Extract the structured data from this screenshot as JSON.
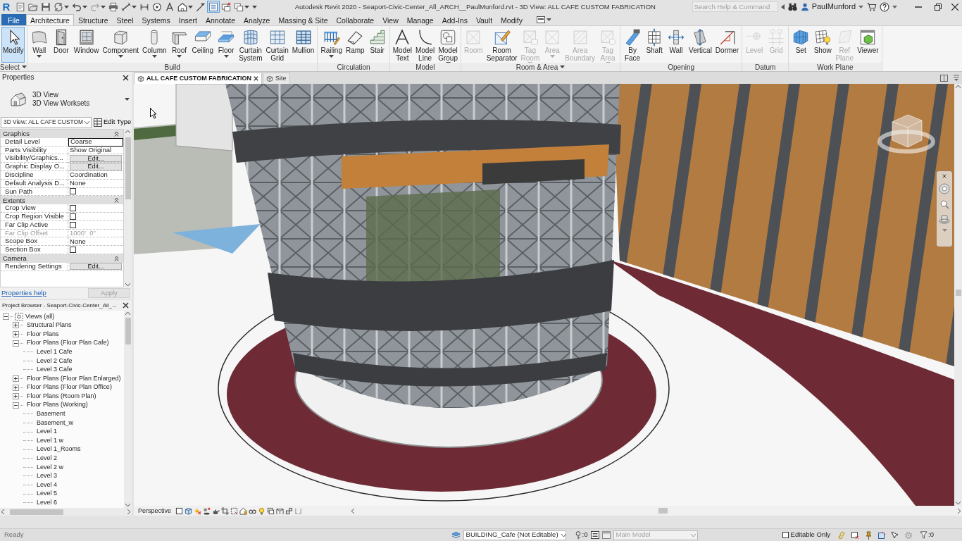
{
  "title_bar": {
    "logo": "R",
    "quick_access": [
      {
        "has_menu": false,
        "on": false,
        "disabled": false
      },
      {
        "has_menu": false,
        "on": false,
        "disabled": false
      },
      {
        "has_menu": false,
        "on": false,
        "disabled": false
      },
      {
        "has_menu": true,
        "on": false,
        "disabled": false
      },
      {
        "has_menu": true,
        "on": false,
        "disabled": false
      },
      {
        "has_menu": true,
        "on": false,
        "disabled": true
      },
      {
        "has_menu": false,
        "on": false,
        "disabled": false
      },
      {
        "has_menu": true,
        "on": false,
        "disabled": false
      },
      {
        "has_menu": false,
        "on": false,
        "disabled": false
      },
      {
        "has_menu": false,
        "on": false,
        "disabled": false
      },
      {
        "has_menu": false,
        "on": false,
        "disabled": false
      },
      {
        "has_menu": true,
        "on": false,
        "disabled": false
      },
      {
        "has_menu": false,
        "on": false,
        "disabled": false
      },
      {
        "has_menu": false,
        "on": true,
        "disabled": false
      },
      {
        "has_menu": false,
        "on": false,
        "disabled": false
      },
      {
        "has_menu": true,
        "on": false,
        "disabled": false
      }
    ],
    "title": "Autodesk Revit 2020 - Seaport-Civic-Center_All_ARCH__PaulMunford.rvt - 3D View: ALL CAFE CUSTOM FABRICATION",
    "search": {
      "placeholder": "Search Help & Command"
    },
    "user": "PaulMunford"
  },
  "ribbon_tabs": [
    {
      "label": "File",
      "kind": "application",
      "selected": false
    },
    {
      "label": "Architecture",
      "kind": "tab",
      "selected": true
    },
    {
      "label": "Structure",
      "kind": "tab",
      "selected": false
    },
    {
      "label": "Steel",
      "kind": "tab",
      "selected": false
    },
    {
      "label": "Systems",
      "kind": "tab",
      "selected": false
    },
    {
      "label": "Insert",
      "kind": "tab",
      "selected": false
    },
    {
      "label": "Annotate",
      "kind": "tab",
      "selected": false
    },
    {
      "label": "Analyze",
      "kind": "tab",
      "selected": false
    },
    {
      "label": "Massing & Site",
      "kind": "tab",
      "selected": false
    },
    {
      "label": "Collaborate",
      "kind": "tab",
      "selected": false
    },
    {
      "label": "View",
      "kind": "tab",
      "selected": false
    },
    {
      "label": "Manage",
      "kind": "tab",
      "selected": false
    },
    {
      "label": "Add-Ins",
      "kind": "tab",
      "selected": false
    },
    {
      "label": "Vault",
      "kind": "tab",
      "selected": false
    },
    {
      "label": "Modify",
      "kind": "tab",
      "selected": false
    }
  ],
  "ribbon_panels": [
    {
      "title": "Select",
      "has_menu": true,
      "buttons": [
        {
          "label": "Modify",
          "selected": true,
          "disabled": false,
          "has_menu": false
        }
      ]
    },
    {
      "title": "Build",
      "has_menu": false,
      "buttons": [
        {
          "label": "Wall",
          "selected": false,
          "disabled": false,
          "has_menu": true
        },
        {
          "label": "Door",
          "selected": false,
          "disabled": false,
          "has_menu": false
        },
        {
          "label": "Window",
          "selected": false,
          "disabled": false,
          "has_menu": false
        },
        {
          "label": "Component",
          "selected": false,
          "disabled": false,
          "has_menu": true
        },
        {
          "label": "Column",
          "selected": false,
          "disabled": false,
          "has_menu": true
        },
        {
          "label": "Roof",
          "selected": false,
          "disabled": false,
          "has_menu": true
        },
        {
          "label": "Ceiling",
          "selected": false,
          "disabled": false,
          "has_menu": false
        },
        {
          "label": "Floor",
          "selected": false,
          "disabled": false,
          "has_menu": true
        },
        {
          "label": "Curtain System",
          "selected": false,
          "disabled": false,
          "has_menu": false
        },
        {
          "label": "Curtain Grid",
          "selected": false,
          "disabled": false,
          "has_menu": false
        },
        {
          "label": "Mullion",
          "selected": false,
          "disabled": false,
          "has_menu": false
        }
      ]
    },
    {
      "title": "Circulation",
      "has_menu": false,
      "buttons": [
        {
          "label": "Railing",
          "selected": false,
          "disabled": false,
          "has_menu": true
        },
        {
          "label": "Ramp",
          "selected": false,
          "disabled": false,
          "has_menu": false
        },
        {
          "label": "Stair",
          "selected": false,
          "disabled": false,
          "has_menu": false
        }
      ]
    },
    {
      "title": "Model",
      "has_menu": false,
      "buttons": [
        {
          "label": "Model Text",
          "selected": false,
          "disabled": false,
          "has_menu": false
        },
        {
          "label": "Model Line",
          "selected": false,
          "disabled": false,
          "has_menu": false
        },
        {
          "label": "Model Group",
          "selected": false,
          "disabled": false,
          "has_menu": true
        }
      ]
    },
    {
      "title": "Room & Area",
      "has_menu": true,
      "buttons": [
        {
          "label": "Room",
          "selected": false,
          "disabled": true,
          "has_menu": false
        },
        {
          "label": "Room Separator",
          "selected": false,
          "disabled": false,
          "has_menu": false
        },
        {
          "label": "Tag Room",
          "selected": false,
          "disabled": true,
          "has_menu": true
        },
        {
          "label": "Area",
          "selected": false,
          "disabled": true,
          "has_menu": true
        },
        {
          "label": "Area Boundary",
          "selected": false,
          "disabled": true,
          "has_menu": false
        },
        {
          "label": "Tag Area",
          "selected": false,
          "disabled": true,
          "has_menu": true
        }
      ]
    },
    {
      "title": "Opening",
      "has_menu": false,
      "buttons": [
        {
          "label": "By Face",
          "selected": false,
          "disabled": false,
          "has_menu": false
        },
        {
          "label": "Shaft",
          "selected": false,
          "disabled": false,
          "has_menu": false
        },
        {
          "label": "Wall",
          "selected": false,
          "disabled": false,
          "has_menu": false
        },
        {
          "label": "Vertical",
          "selected": false,
          "disabled": false,
          "has_menu": false
        },
        {
          "label": "Dormer",
          "selected": false,
          "disabled": false,
          "has_menu": false
        }
      ]
    },
    {
      "title": "Datum",
      "has_menu": false,
      "buttons": [
        {
          "label": "Level",
          "selected": false,
          "disabled": true,
          "has_menu": false
        },
        {
          "label": "Grid",
          "selected": false,
          "disabled": true,
          "has_menu": false
        }
      ]
    },
    {
      "title": "Work Plane",
      "has_menu": false,
      "buttons": [
        {
          "label": "Set",
          "selected": false,
          "disabled": false,
          "has_menu": false
        },
        {
          "label": "Show",
          "selected": false,
          "disabled": false,
          "has_menu": false
        },
        {
          "label": "Ref Plane",
          "selected": false,
          "disabled": true,
          "has_menu": false
        },
        {
          "label": "Viewer",
          "selected": false,
          "disabled": false,
          "has_menu": false
        }
      ]
    }
  ],
  "properties": {
    "title": "Properties",
    "type_name": "3D View",
    "type_detail": "3D View Worksets",
    "instance": "3D View: ALL CAFE CUSTOM",
    "edit_type": "Edit Type",
    "groups": [
      {
        "title": "Graphics",
        "expanded": true,
        "rows": [
          {
            "label": "Detail Level",
            "kind": "text",
            "value": "Coarse",
            "editing": true,
            "disabled": false
          },
          {
            "label": "Parts Visibility",
            "kind": "text",
            "value": "Show Original",
            "editing": false,
            "disabled": false
          },
          {
            "label": "Visibility/Graphics...",
            "kind": "button",
            "value": "Edit...",
            "editing": false,
            "disabled": false
          },
          {
            "label": "Graphic Display O...",
            "kind": "button",
            "value": "Edit...",
            "editing": false,
            "disabled": false
          },
          {
            "label": "Discipline",
            "kind": "text",
            "value": "Coordination",
            "editing": false,
            "disabled": false
          },
          {
            "label": "Default Analysis D...",
            "kind": "text",
            "value": "None",
            "editing": false,
            "disabled": false
          },
          {
            "label": "Sun Path",
            "kind": "checkbox",
            "checked": false,
            "editing": false,
            "disabled": false
          }
        ]
      },
      {
        "title": "Extents",
        "expanded": true,
        "rows": [
          {
            "label": "Crop View",
            "kind": "checkbox",
            "checked": false,
            "editing": false,
            "disabled": false
          },
          {
            "label": "Crop Region Visible",
            "kind": "checkbox",
            "checked": false,
            "editing": false,
            "disabled": false
          },
          {
            "label": "Far Clip Active",
            "kind": "checkbox",
            "checked": false,
            "editing": false,
            "disabled": false
          },
          {
            "label": "Far Clip Offset",
            "kind": "text",
            "value": "1000'  0\"",
            "editing": false,
            "disabled": true
          },
          {
            "label": "Scope Box",
            "kind": "text",
            "value": "None",
            "editing": false,
            "disabled": false
          },
          {
            "label": "Section Box",
            "kind": "checkbox",
            "checked": false,
            "editing": false,
            "disabled": false
          }
        ]
      },
      {
        "title": "Camera",
        "expanded": true,
        "rows": [
          {
            "label": "Rendering Settings",
            "kind": "button",
            "value": "Edit...",
            "editing": false,
            "disabled": false
          }
        ]
      }
    ],
    "help": "Properties help",
    "apply": {
      "label": "Apply",
      "disabled": true
    }
  },
  "project_browser": {
    "title": "Project Browser - Seaport-Civic-Center_All_...",
    "tree": [
      {
        "label": "Views (all)",
        "expanded": true,
        "children": [
          {
            "label": "Structural Plans",
            "expanded": false
          },
          {
            "label": "Floor Plans",
            "expanded": false
          },
          {
            "label": "Floor Plans (Floor Plan Cafe)",
            "expanded": true,
            "children": [
              {
                "label": "Level 1 Cafe"
              },
              {
                "label": "Level 2 Cafe"
              },
              {
                "label": "Level 3 Cafe"
              }
            ]
          },
          {
            "label": "Floor Plans (Floor Plan Enlarged)",
            "expanded": false
          },
          {
            "label": "Floor Plans (Floor Plan Office)",
            "expanded": false
          },
          {
            "label": "Floor Plans (Room Plan)",
            "expanded": false
          },
          {
            "label": "Floor Plans (Working)",
            "expanded": true,
            "children": [
              {
                "label": "Basement"
              },
              {
                "label": "Basement_w"
              },
              {
                "label": "Level 1"
              },
              {
                "label": "Level 1 w"
              },
              {
                "label": "Level 1_Rooms"
              },
              {
                "label": "Level 2"
              },
              {
                "label": "Level 2 w"
              },
              {
                "label": "Level 3"
              },
              {
                "label": "Level 4"
              },
              {
                "label": "Level 5"
              },
              {
                "label": "Level 6"
              }
            ]
          }
        ]
      }
    ]
  },
  "view_tabs": [
    {
      "label": "ALL CAFE CUSTOM FABRICATION",
      "selected": true
    },
    {
      "label": "Site",
      "selected": false
    }
  ],
  "view_control_bar": {
    "label": "Perspective"
  },
  "status_bar": {
    "status": "Ready",
    "workset": "BUILDING_Cafe (Not Editable)",
    "workset_count": ":0",
    "design_option": {
      "label": "Main Model",
      "disabled": true
    },
    "editable_only": {
      "label": "Editable Only",
      "checked": false
    },
    "filter_count": ":0"
  }
}
